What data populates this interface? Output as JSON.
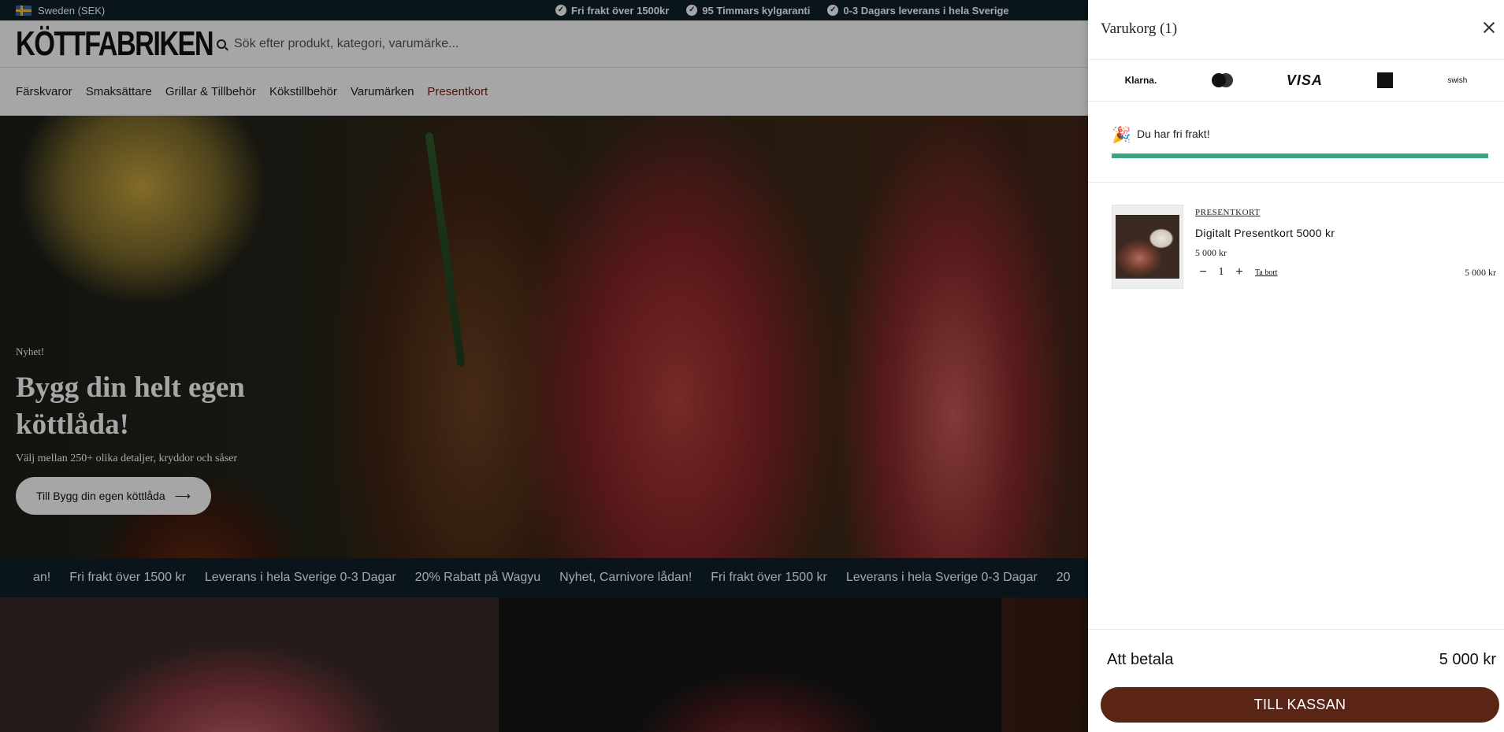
{
  "topbar": {
    "locale": "Sweden (SEK)",
    "usps": [
      "Fri frakt över 1500kr",
      "95 Timmars kylgaranti",
      "0-3 Dagars leverans i hela Sverige"
    ]
  },
  "header": {
    "logo": "KÖTTFABRIKEN",
    "search_placeholder": "Sök efter produkt, kategori, varumärke..."
  },
  "nav": {
    "items": [
      "Färskvaror",
      "Smaksättare",
      "Grillar & Tillbehör",
      "Kökstillbehör",
      "Varumärken",
      "Presentkort"
    ]
  },
  "hero": {
    "kicker": "Nyhet!",
    "title": "Bygg din helt egen köttlåda!",
    "subtitle": "Välj mellan 250+ olika detaljer, kryddor och såser",
    "cta": "Till Bygg din egen köttlåda",
    "cta_icon": "arrow-right-icon"
  },
  "marquee": {
    "items": [
      "an!",
      "Fri frakt över 1500 kr",
      "Leverans i hela Sverige 0-3 Dagar",
      "20% Rabatt på Wagyu",
      "Nyhet, Carnivore lådan!",
      "Fri frakt över 1500 kr",
      "Leverans i hela Sverige 0-3 Dagar",
      "20"
    ]
  },
  "cart": {
    "title": "Varukorg (1)",
    "payment_methods": [
      "Klarna.",
      "mastercard",
      "VISA",
      "amex",
      "swish"
    ],
    "free_shipping": {
      "text": "Du har fri frakt!",
      "progress": 1.0,
      "color": "#3aa67d"
    },
    "item": {
      "vendor": "PRESENTKORT",
      "name": "Digitalt Presentkort 5000 kr",
      "price": "5 000 kr",
      "quantity": "1",
      "remove_label": "Ta bort",
      "line_total": "5 000 kr"
    },
    "total_label": "Att betala",
    "total_value": "5 000 kr",
    "checkout_label": "TILL KASSAN",
    "checkout_color": "#5a2517"
  }
}
